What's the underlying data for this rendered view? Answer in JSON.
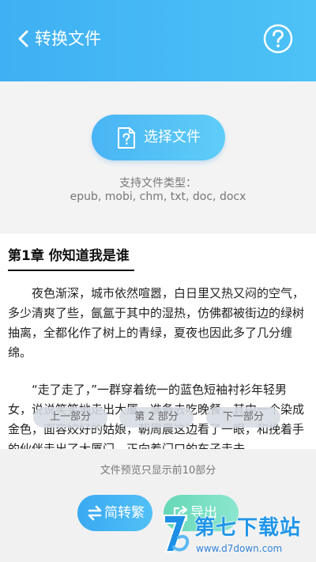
{
  "header": {
    "title": "转换文件"
  },
  "picker": {
    "button_label": "选择文件",
    "types_title": "支持文件类型：",
    "types_list": "epub, mobi, chm, txt, doc, docx"
  },
  "preview": {
    "chapter_title": "第1章 你知道我是谁",
    "paragraphs": [
      "夜色渐深，城市依然喧嚣，白日里又热又闷的空气，多少清爽了些，氤氲于其中的湿热，仿佛都被街边的绿树抽离，全都化作了树上的青绿，夏夜也因此多了几分缠绵。",
      "“走了走了，”一群穿着统一的蓝色短袖衬衫年轻男女，说说笑笑地走出大厦，准备去吃晚餐，其中一个染成金色，面容姣好的姑娘，朝周晨这边看了一眼，和挽着手的伙伴走出了大厦门，正向着门口的车子走去。"
    ]
  },
  "segments": {
    "prev": "上一部分",
    "current": "第 2 部分",
    "next": "下一部分"
  },
  "footer": {
    "note": "文件预览只显示前10部分",
    "convert_label": "简转繁",
    "export_label": "导出"
  },
  "watermark": {
    "name": "第七下载站",
    "url": "www.d7down.com"
  }
}
